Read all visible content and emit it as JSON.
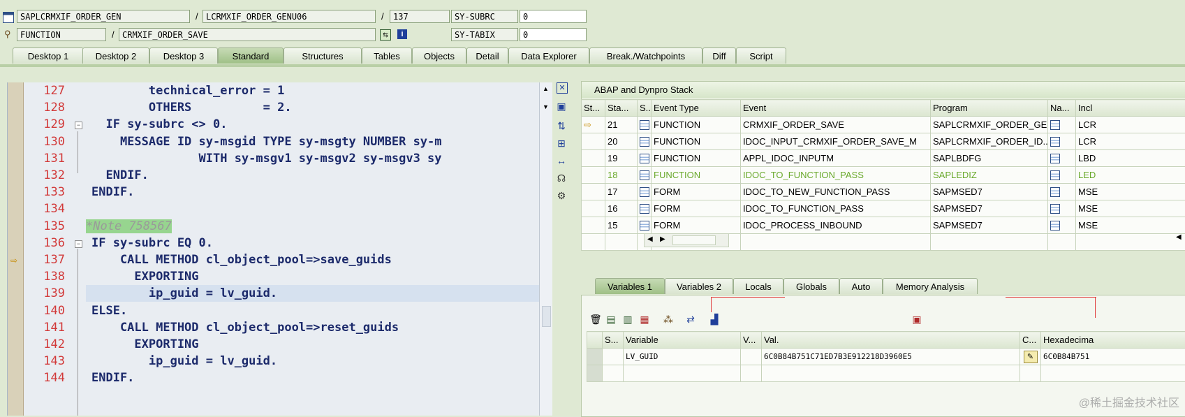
{
  "header": {
    "program": "SAPLCRMXIF_ORDER_GEN",
    "include": "LCRMXIF_ORDER_GENU06",
    "line": "137",
    "subrc_label": "SY-SUBRC",
    "subrc_value": "0",
    "type": "FUNCTION",
    "name": "CRMXIF_ORDER_SAVE",
    "tabix_label": "SY-TABIX",
    "tabix_value": "0",
    "slash": "/"
  },
  "tabs": [
    "Desktop 1",
    "Desktop 2",
    "Desktop 3",
    "Standard",
    "Structures",
    "Tables",
    "Objects",
    "Detail",
    "Data Explorer",
    "Break./Watchpoints",
    "Diff",
    "Script"
  ],
  "code": {
    "lines": [
      {
        "n": "127",
        "t": "        technical_error = 1"
      },
      {
        "n": "128",
        "t": "        OTHERS          = 2."
      },
      {
        "n": "129",
        "t": "  IF sy-subrc <> 0."
      },
      {
        "n": "130",
        "t": "    MESSAGE ID sy-msgid TYPE sy-msgty NUMBER sy-m"
      },
      {
        "n": "131",
        "t": "               WITH sy-msgv1 sy-msgv2 sy-msgv3 sy"
      },
      {
        "n": "132",
        "t": "  ENDIF."
      },
      {
        "n": "133",
        "t": "ENDIF."
      },
      {
        "n": "134",
        "t": ""
      },
      {
        "n": "135",
        "t": "*Note 758567"
      },
      {
        "n": "136",
        "t": "IF sy-subrc EQ 0."
      },
      {
        "n": "137",
        "t": "    CALL METHOD cl_object_pool=>save_guids"
      },
      {
        "n": "138",
        "t": "      EXPORTING"
      },
      {
        "n": "139",
        "t": "        ip_guid = lv_guid."
      },
      {
        "n": "140",
        "t": "ELSE."
      },
      {
        "n": "141",
        "t": "    CALL METHOD cl_object_pool=>reset_guids"
      },
      {
        "n": "142",
        "t": "      EXPORTING"
      },
      {
        "n": "143",
        "t": "        ip_guid = lv_guid."
      },
      {
        "n": "144",
        "t": "ENDIF."
      }
    ]
  },
  "stack": {
    "title": "ABAP and Dynpro Stack",
    "columns": [
      "St...",
      "Sta...",
      "S..",
      "Event Type",
      "Event",
      "Program",
      "Na...",
      "Incl"
    ],
    "rows": [
      {
        "level": "21",
        "type": "FUNCTION",
        "event": "CRMXIF_ORDER_SAVE",
        "program": "SAPLCRMXIF_ORDER_GEN",
        "incl": "LCR"
      },
      {
        "level": "20",
        "type": "FUNCTION",
        "event": "IDOC_INPUT_CRMXIF_ORDER_SAVE_M",
        "program": "SAPLCRMXIF_ORDER_ID...",
        "incl": "LCR"
      },
      {
        "level": "19",
        "type": "FUNCTION",
        "event": "APPL_IDOC_INPUTM",
        "program": "SAPLBDFG",
        "incl": "LBD"
      },
      {
        "level": "18",
        "type": "FUNCTION",
        "event": "IDOC_TO_FUNCTION_PASS",
        "program": "SAPLEDIZ",
        "incl": "LED"
      },
      {
        "level": "17",
        "type": "FORM",
        "event": "IDOC_TO_NEW_FUNCTION_PASS",
        "program": "SAPMSED7",
        "incl": "MSE"
      },
      {
        "level": "16",
        "type": "FORM",
        "event": "IDOC_TO_FUNCTION_PASS",
        "program": "SAPMSED7",
        "incl": "MSE"
      },
      {
        "level": "15",
        "type": "FORM",
        "event": "IDOC_PROCESS_INBOUND",
        "program": "SAPMSED7",
        "incl": "MSE"
      }
    ]
  },
  "var_tabs": [
    "Variables 1",
    "Variables 2",
    "Locals",
    "Globals",
    "Auto",
    "Memory Analysis"
  ],
  "vars": {
    "columns": [
      "S...",
      "Variable",
      "V...",
      "Val.",
      "C...",
      "Hexadecima"
    ],
    "rows": [
      {
        "name": "LV_GUID",
        "value": "6C0B84B751C71ED7B3E912218D3960E5",
        "hex": "6C0B84B751"
      }
    ]
  },
  "watermark": "@稀土掘金技术社区"
}
